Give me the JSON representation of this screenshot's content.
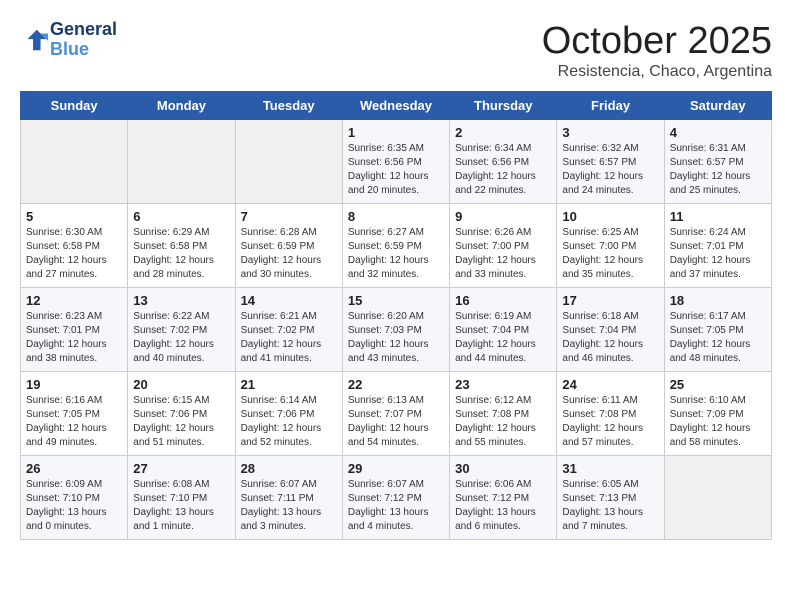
{
  "logo": {
    "line1": "General",
    "line2": "Blue"
  },
  "title": "October 2025",
  "subtitle": "Resistencia, Chaco, Argentina",
  "days_of_week": [
    "Sunday",
    "Monday",
    "Tuesday",
    "Wednesday",
    "Thursday",
    "Friday",
    "Saturday"
  ],
  "weeks": [
    [
      {
        "day": "",
        "info": ""
      },
      {
        "day": "",
        "info": ""
      },
      {
        "day": "",
        "info": ""
      },
      {
        "day": "1",
        "info": "Sunrise: 6:35 AM\nSunset: 6:56 PM\nDaylight: 12 hours\nand 20 minutes."
      },
      {
        "day": "2",
        "info": "Sunrise: 6:34 AM\nSunset: 6:56 PM\nDaylight: 12 hours\nand 22 minutes."
      },
      {
        "day": "3",
        "info": "Sunrise: 6:32 AM\nSunset: 6:57 PM\nDaylight: 12 hours\nand 24 minutes."
      },
      {
        "day": "4",
        "info": "Sunrise: 6:31 AM\nSunset: 6:57 PM\nDaylight: 12 hours\nand 25 minutes."
      }
    ],
    [
      {
        "day": "5",
        "info": "Sunrise: 6:30 AM\nSunset: 6:58 PM\nDaylight: 12 hours\nand 27 minutes."
      },
      {
        "day": "6",
        "info": "Sunrise: 6:29 AM\nSunset: 6:58 PM\nDaylight: 12 hours\nand 28 minutes."
      },
      {
        "day": "7",
        "info": "Sunrise: 6:28 AM\nSunset: 6:59 PM\nDaylight: 12 hours\nand 30 minutes."
      },
      {
        "day": "8",
        "info": "Sunrise: 6:27 AM\nSunset: 6:59 PM\nDaylight: 12 hours\nand 32 minutes."
      },
      {
        "day": "9",
        "info": "Sunrise: 6:26 AM\nSunset: 7:00 PM\nDaylight: 12 hours\nand 33 minutes."
      },
      {
        "day": "10",
        "info": "Sunrise: 6:25 AM\nSunset: 7:00 PM\nDaylight: 12 hours\nand 35 minutes."
      },
      {
        "day": "11",
        "info": "Sunrise: 6:24 AM\nSunset: 7:01 PM\nDaylight: 12 hours\nand 37 minutes."
      }
    ],
    [
      {
        "day": "12",
        "info": "Sunrise: 6:23 AM\nSunset: 7:01 PM\nDaylight: 12 hours\nand 38 minutes."
      },
      {
        "day": "13",
        "info": "Sunrise: 6:22 AM\nSunset: 7:02 PM\nDaylight: 12 hours\nand 40 minutes."
      },
      {
        "day": "14",
        "info": "Sunrise: 6:21 AM\nSunset: 7:02 PM\nDaylight: 12 hours\nand 41 minutes."
      },
      {
        "day": "15",
        "info": "Sunrise: 6:20 AM\nSunset: 7:03 PM\nDaylight: 12 hours\nand 43 minutes."
      },
      {
        "day": "16",
        "info": "Sunrise: 6:19 AM\nSunset: 7:04 PM\nDaylight: 12 hours\nand 44 minutes."
      },
      {
        "day": "17",
        "info": "Sunrise: 6:18 AM\nSunset: 7:04 PM\nDaylight: 12 hours\nand 46 minutes."
      },
      {
        "day": "18",
        "info": "Sunrise: 6:17 AM\nSunset: 7:05 PM\nDaylight: 12 hours\nand 48 minutes."
      }
    ],
    [
      {
        "day": "19",
        "info": "Sunrise: 6:16 AM\nSunset: 7:05 PM\nDaylight: 12 hours\nand 49 minutes."
      },
      {
        "day": "20",
        "info": "Sunrise: 6:15 AM\nSunset: 7:06 PM\nDaylight: 12 hours\nand 51 minutes."
      },
      {
        "day": "21",
        "info": "Sunrise: 6:14 AM\nSunset: 7:06 PM\nDaylight: 12 hours\nand 52 minutes."
      },
      {
        "day": "22",
        "info": "Sunrise: 6:13 AM\nSunset: 7:07 PM\nDaylight: 12 hours\nand 54 minutes."
      },
      {
        "day": "23",
        "info": "Sunrise: 6:12 AM\nSunset: 7:08 PM\nDaylight: 12 hours\nand 55 minutes."
      },
      {
        "day": "24",
        "info": "Sunrise: 6:11 AM\nSunset: 7:08 PM\nDaylight: 12 hours\nand 57 minutes."
      },
      {
        "day": "25",
        "info": "Sunrise: 6:10 AM\nSunset: 7:09 PM\nDaylight: 12 hours\nand 58 minutes."
      }
    ],
    [
      {
        "day": "26",
        "info": "Sunrise: 6:09 AM\nSunset: 7:10 PM\nDaylight: 13 hours\nand 0 minutes."
      },
      {
        "day": "27",
        "info": "Sunrise: 6:08 AM\nSunset: 7:10 PM\nDaylight: 13 hours\nand 1 minute."
      },
      {
        "day": "28",
        "info": "Sunrise: 6:07 AM\nSunset: 7:11 PM\nDaylight: 13 hours\nand 3 minutes."
      },
      {
        "day": "29",
        "info": "Sunrise: 6:07 AM\nSunset: 7:12 PM\nDaylight: 13 hours\nand 4 minutes."
      },
      {
        "day": "30",
        "info": "Sunrise: 6:06 AM\nSunset: 7:12 PM\nDaylight: 13 hours\nand 6 minutes."
      },
      {
        "day": "31",
        "info": "Sunrise: 6:05 AM\nSunset: 7:13 PM\nDaylight: 13 hours\nand 7 minutes."
      },
      {
        "day": "",
        "info": ""
      }
    ]
  ]
}
